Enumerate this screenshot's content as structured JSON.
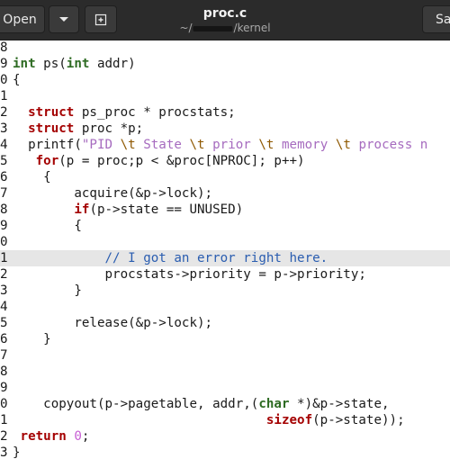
{
  "app": {
    "open_label": "Open",
    "dropdown_icon": "chevron-down-icon",
    "newdoc_icon": "new-document-icon",
    "save_label": "Sa",
    "title": "proc.c",
    "subtitle_prefix": "~/",
    "subtitle_suffix": "/kernel"
  },
  "editor": {
    "current_line": "1",
    "lines": [
      {
        "n": "8",
        "code": ""
      },
      {
        "n": "9",
        "code": "int ps(int addr)"
      },
      {
        "n": "0",
        "code": "{"
      },
      {
        "n": "1",
        "code": ""
      },
      {
        "n": "2",
        "code": "  struct ps_proc * procstats;"
      },
      {
        "n": "3",
        "code": "  struct proc *p;"
      },
      {
        "n": "4",
        "code": "  printf(\"PID \\t State \\t prior \\t memory \\t process n"
      },
      {
        "n": "5",
        "code": "   for(p = proc;p < &proc[NPROC]; p++)"
      },
      {
        "n": "6",
        "code": "    {"
      },
      {
        "n": "7",
        "code": "        acquire(&p->lock);"
      },
      {
        "n": "8",
        "code": "        if(p->state == UNUSED)"
      },
      {
        "n": "9",
        "code": "        {"
      },
      {
        "n": "0",
        "code": ""
      },
      {
        "n": "1",
        "code": "            // I got an error right here."
      },
      {
        "n": "2",
        "code": "            procstats->priority = p->priority;"
      },
      {
        "n": "3",
        "code": "        }"
      },
      {
        "n": "4",
        "code": ""
      },
      {
        "n": "5",
        "code": "        release(&p->lock);"
      },
      {
        "n": "6",
        "code": "    }"
      },
      {
        "n": "7",
        "code": ""
      },
      {
        "n": "8",
        "code": ""
      },
      {
        "n": "9",
        "code": ""
      },
      {
        "n": "0",
        "code": "    copyout(p->pagetable, addr,(char *)&p->state,"
      },
      {
        "n": "1",
        "code": "                                 sizeof(p->state));"
      },
      {
        "n": "2",
        "code": " return 0;"
      },
      {
        "n": "3",
        "code": "}"
      }
    ]
  }
}
